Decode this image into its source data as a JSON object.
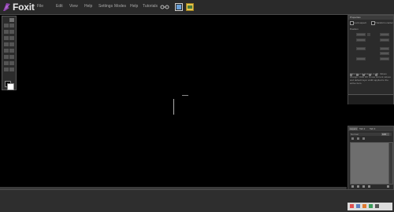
{
  "app": {
    "name": "Foxit",
    "accent": "#8e44ad"
  },
  "menu": [
    "File",
    "Edit",
    "View",
    "Help",
    "Settings",
    "Modes",
    "Help",
    "Tutorials"
  ],
  "panels": {
    "properties": {
      "title": "Properties",
      "check_labels": [
        "Lock aspect",
        "Transform center"
      ],
      "section": "Position",
      "desc": "Click layer to arrange in 3D. Values change. Click OK to use current values and default layer width applied to the active item."
    },
    "layers": {
      "tabs": [
        "Layers",
        "Tab 2",
        "Tab 3"
      ],
      "blend": "Normal",
      "opacity": "100"
    }
  },
  "colors": {
    "canvas": "#000000",
    "chrome": "#2a2a2a",
    "panel": "#2b2b2b",
    "list": "#6e6e6e"
  },
  "icons": [
    "arrow-tool-icon",
    "move-tool-icon",
    "pen-tool-icon",
    "crop-tool-icon",
    "text-tool-icon",
    "hand-tool-icon",
    "zoom-tool-icon",
    "undo-icon",
    "redo-icon"
  ]
}
